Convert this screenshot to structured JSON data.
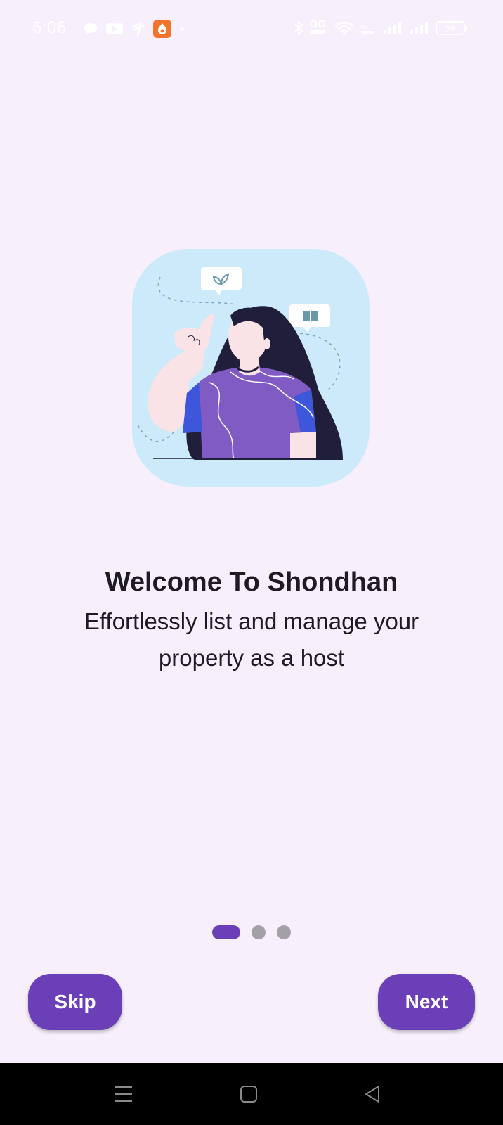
{
  "status_bar": {
    "time": "6:06",
    "battery": "56",
    "left_icons": [
      "chat-bubble-icon",
      "youtube-icon",
      "signal-app-icon",
      "app-badge-icon",
      "dot-icon"
    ],
    "right_icons": [
      "bluetooth-icon",
      "data-speed-icon",
      "wifi-icon",
      "volte-icon",
      "signal-bars-icon",
      "signal-bars-icon",
      "battery-icon"
    ]
  },
  "onboarding": {
    "title": "Welcome To Shondhan",
    "subtitle": "Effortlessly list and manage your property as a host",
    "page_count": 3,
    "active_page": 0
  },
  "buttons": {
    "skip_label": "Skip",
    "next_label": "Next"
  },
  "colors": {
    "background": "#f7effb",
    "accent": "#6a3fb8",
    "dot_inactive": "#a3a1a6",
    "illustration_bg": "#cdeafb"
  },
  "nav_bar": {
    "icons": [
      "menu-icon",
      "home-square-icon",
      "back-triangle-icon"
    ]
  }
}
